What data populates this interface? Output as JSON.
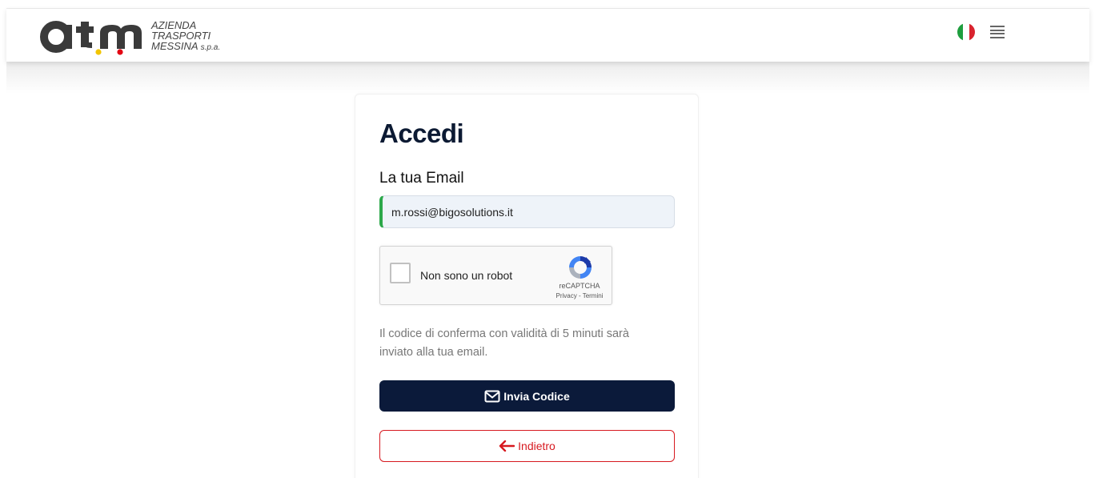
{
  "header": {
    "logo_line1": "AZIENDA",
    "logo_line2": "TRASPORTI",
    "logo_line3": "MESSINA",
    "logo_suffix": "s.p.a.",
    "language_flag": "italy-flag-icon",
    "menu_icon": "hamburger-menu-icon"
  },
  "login": {
    "title": "Accedi",
    "email_label": "La tua Email",
    "email_value": "m.rossi@bigosolutions.it",
    "captcha": {
      "label": "Non sono un robot",
      "brand": "reCAPTCHA",
      "links": "Privacy - Termini",
      "checked": false
    },
    "info_text": "Il codice di conferma con validità di 5 minuti sarà inviato alla tua email.",
    "send_button": "Invia Codice",
    "back_button": "Indietro"
  },
  "colors": {
    "primary_dark": "#0b1a3a",
    "danger_red": "#d7191f",
    "success_green": "#2ca84a",
    "logo_yellow": "#f2c500",
    "logo_red": "#e30613"
  }
}
